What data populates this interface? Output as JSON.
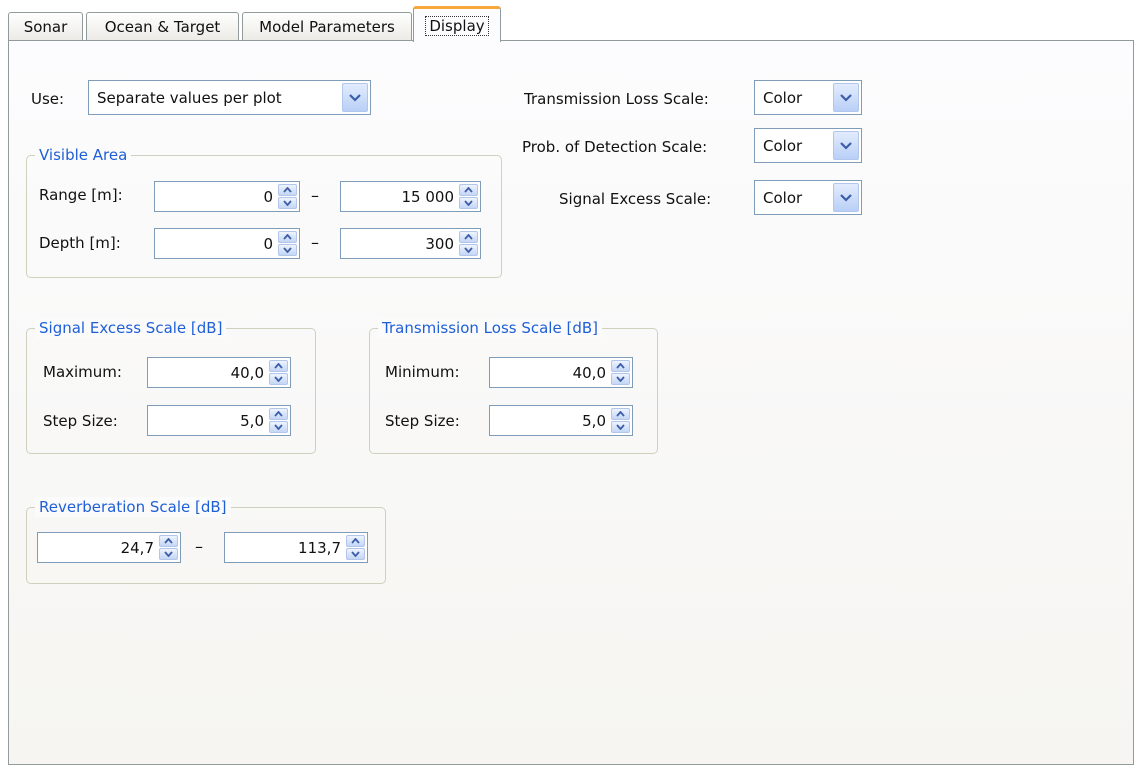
{
  "tabs": [
    {
      "label": "Sonar",
      "active": false
    },
    {
      "label": "Ocean & Target",
      "active": false
    },
    {
      "label": "Model Parameters",
      "active": false
    },
    {
      "label": "Display",
      "active": true
    }
  ],
  "use": {
    "label": "Use:",
    "value": "Separate values per plot"
  },
  "scales": {
    "transmission_loss": {
      "label": "Transmission Loss Scale:",
      "value": "Color"
    },
    "prob_detection": {
      "label": "Prob. of Detection Scale:",
      "value": "Color"
    },
    "signal_excess": {
      "label": "Signal Excess Scale:",
      "value": "Color"
    }
  },
  "visible_area": {
    "title": "Visible Area",
    "range_label": "Range [m]:",
    "range_min": "0",
    "range_max": "15 000",
    "depth_label": "Depth [m]:",
    "depth_min": "0",
    "depth_max": "300",
    "separator": "–"
  },
  "signal_excess_scale": {
    "title": "Signal Excess Scale [dB]",
    "maximum_label": "Maximum:",
    "maximum": "40,0",
    "step_label": "Step Size:",
    "step": "5,0"
  },
  "transmission_loss_scale": {
    "title": "Transmission Loss Scale [dB]",
    "minimum_label": "Minimum:",
    "minimum": "40,0",
    "step_label": "Step Size:",
    "step": "5,0"
  },
  "reverberation_scale": {
    "title": "Reverberation Scale [dB]",
    "min": "24,7",
    "max": "113,7",
    "separator": "–"
  },
  "colors": {
    "group_title": "#1f5fd6",
    "active_tab_accent": "#f7a83c",
    "field_border": "#7f9db9"
  },
  "icons": {
    "dropdown": "chevron-down-icon",
    "spin_up": "spin-up-icon",
    "spin_down": "spin-down-icon"
  }
}
